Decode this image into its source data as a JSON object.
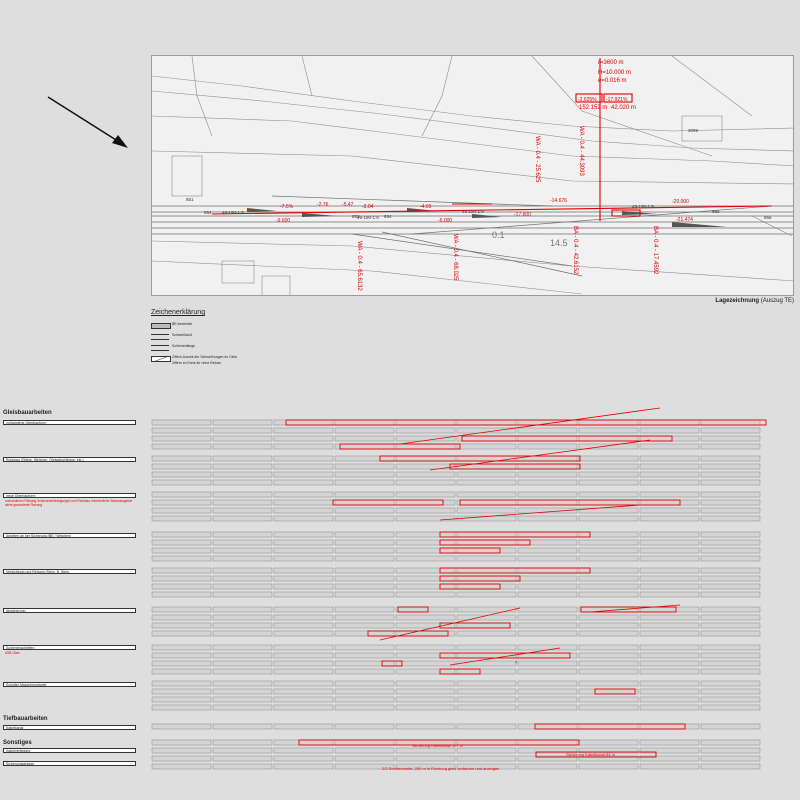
{
  "map": {
    "caption_bold": "Lagezeichnung",
    "caption_rest": "(Auszug TE)",
    "alignment_callout": [
      "r=3600 m",
      "H=10.000 m",
      "e=0.016 m"
    ],
    "callout_box_left": "-2.625%",
    "callout_box_right": "-17.921%",
    "km_labels": [
      "152.152 m",
      "42.020 m"
    ],
    "gradients": [
      "-7.5%",
      "-9.600",
      "-4.60",
      "-6.000",
      "-3.04",
      "-17.600",
      "-14.676",
      "-20.000",
      "-21.474",
      "-5.47",
      "-2.76"
    ],
    "rotated_labels": [
      "WA - 0.4 - 25.625",
      "WA - 0.4 - 44.3093",
      "WA - 0.4 - 68.025",
      "BA - 0.4 - 42.6152",
      "BA - 0.4 - 17.4592",
      "WA - 0.4 - 65.6132"
    ],
    "switch_labels": [
      "49-190-1:9",
      "49-190-1:9",
      "49-190-1:9",
      "49-190-1:9"
    ],
    "track_numbers": [
      "851",
      "852",
      "853",
      "854",
      "855",
      "856"
    ],
    "km_mark": "14.5",
    "km_mark2": "0.1",
    "house_number": "3099"
  },
  "legend": {
    "title": "Zeichenerklärung",
    "items": [
      "BE innerhalb",
      "Schweißstoß",
      "Schienenlänge",
      "Ziffern Anzahl der Schweißungen im Gleis",
      "Ziffern im Kreis für ohne Einbau"
    ]
  },
  "sections": {
    "gleisbau": "Gleisbauarbeiten",
    "tiefbau": "Tiefbauarbeiten",
    "sonstiges": "Sonstiges"
  },
  "rows": [
    {
      "label": "vorhandene Oberbauform",
      "red": false
    },
    {
      "label": "Rückbau (Gleise, Weichen, Gleisabschlüsse, etc.)",
      "red": false
    },
    {
      "label": "neue Oberbauform",
      "red": false,
      "note": "vorhandenen Planung Schienenbefestigungen und Rückbau erforderlicher Bestandsgleise siehe gesonderte Planung"
    },
    {
      "label": "Arbeiten an der Sicherung (BE / Weichen)",
      "red": false
    },
    {
      "label": "Verdichtung und Rettung (Stein. B. Stein.",
      "red": false
    },
    {
      "label": "Absicherung",
      "red": false
    },
    {
      "label": "Schienenschleifen",
      "red": false,
      "note": "ASB-Gleis"
    },
    {
      "label": "Schotter Maschinenstopfe",
      "red": false
    },
    {
      "label": "Kabelkanal",
      "red": false,
      "section": "tiefbau"
    },
    {
      "label": "Kabelverlegung",
      "red": false,
      "section": "sonstiges"
    },
    {
      "label": "Sicherungsanlage",
      "red": false
    }
  ],
  "annotations": {
    "ohne_bau": "Sicherung Kabelkanal 127 m",
    "kabel_right": "Sicherung Kabelkanal 84 m",
    "bottom_note": "2/3 Streifenbreite, 250 m in Richtung gleis verfahren und anzeigen",
    "circle_mark": "4"
  },
  "colors": {
    "red": "#e00000",
    "grid": "#8a8a8a",
    "map_bg": "#f1f1f1"
  }
}
